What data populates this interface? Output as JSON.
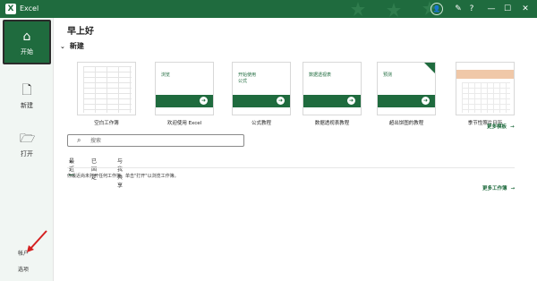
{
  "titlebar": {
    "app_icon": "excel-logo",
    "app_icon_letter": "X",
    "title": "Excel",
    "user_icon": "person-icon",
    "feedback_icon": "feedback-icon",
    "help_icon": "help-icon",
    "minimize": "—",
    "maximize": "☐",
    "close": "✕"
  },
  "sidebar": {
    "items": [
      {
        "label": "开始",
        "icon": "home-icon",
        "glyph": "⌂",
        "active": true
      },
      {
        "label": "新建",
        "icon": "new-file-icon",
        "glyph": "🗋",
        "active": false
      },
      {
        "label": "打开",
        "icon": "folder-icon",
        "glyph": "🗁",
        "active": false
      }
    ],
    "account": "帐户",
    "options": "选项"
  },
  "main": {
    "greeting": "早上好",
    "new_section_title": "新建",
    "templates": [
      {
        "label": "空白工作簿",
        "kind": "blank"
      },
      {
        "label": "欢迎使用 Excel",
        "kind": "welcome",
        "thumb_text": "浏览"
      },
      {
        "label": "公式教程",
        "kind": "formula",
        "thumb_text": "开始使用\n公式"
      },
      {
        "label": "数据透视表教程",
        "kind": "pivot",
        "thumb_text": "数据透视表"
      },
      {
        "label": "超出饼图的教程",
        "kind": "chart",
        "thumb_text": "预测"
      },
      {
        "label": "季节性照片日历",
        "kind": "calendar"
      }
    ],
    "more_templates": "更多模板",
    "search": {
      "placeholder": "搜索"
    },
    "tabs": [
      {
        "label": "最近",
        "active": true
      },
      {
        "label": "已固定",
        "active": false
      },
      {
        "label": "与我共享",
        "active": false
      }
    ],
    "empty_message": "你最近尚未打开任何工作簿。单击\"打开\"以浏览工作簿。",
    "more_workbooks": "更多工作簿"
  },
  "colors": {
    "brand": "#1f6b3e",
    "sidebar_bg": "#f1f6f3"
  }
}
